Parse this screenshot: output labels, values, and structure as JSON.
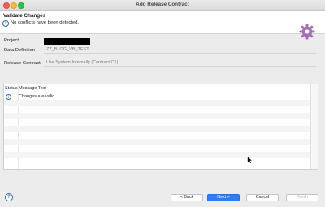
{
  "window": {
    "title": "Add Release Contract"
  },
  "banner": {
    "title": "Validate Changes",
    "message": "No conflicts have been detected.",
    "banner_icon": "gear-icon"
  },
  "form": {
    "project_label": "Project:",
    "data_definition_label": "Data Definition",
    "data_definition_value": "ZZ_BLOG_VB_TEST",
    "release_contract_label": "Release Contract:",
    "release_contract_value": "Use System-Internally (Contract C1)"
  },
  "table": {
    "columns": [
      "Status",
      "Message Text"
    ],
    "rows": [
      {
        "status_icon": "info-icon",
        "text": "Changes are valid."
      }
    ]
  },
  "buttons": {
    "back": "< Back",
    "next": "Next >",
    "cancel": "Cancel",
    "finish": "Finish"
  },
  "colors": {
    "primary": "#2d7df6",
    "info": "#2d6ab0",
    "gear": "#a56bb8"
  }
}
